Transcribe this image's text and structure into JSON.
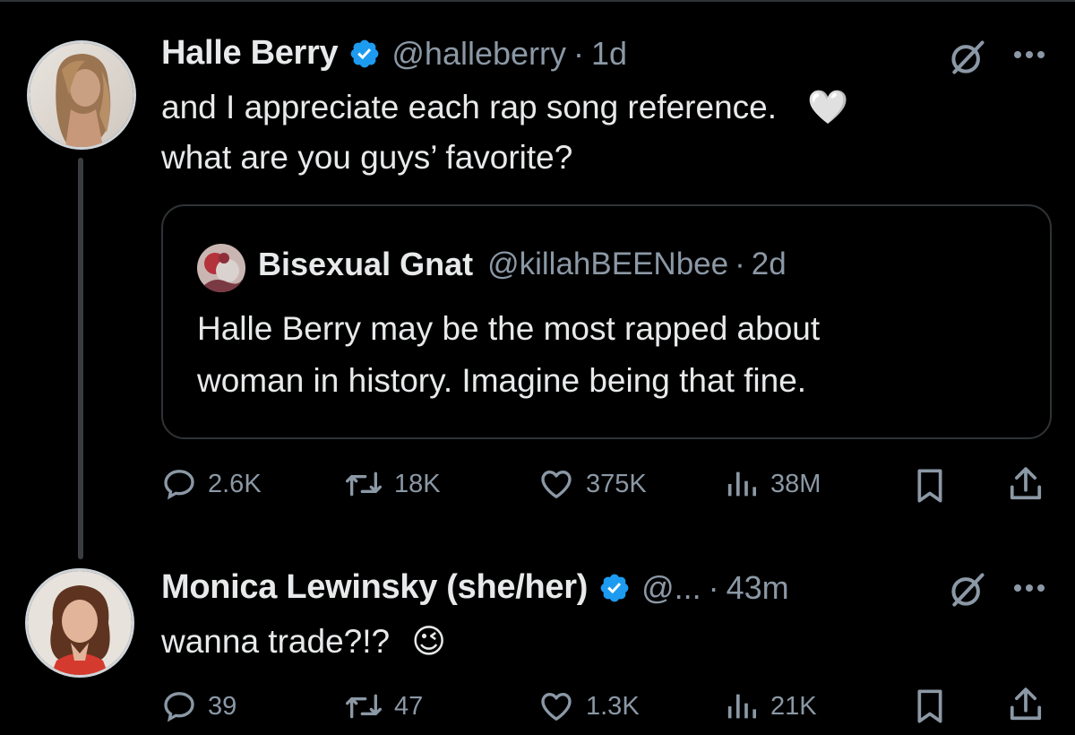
{
  "tweets": [
    {
      "display_name": "Halle Berry",
      "handle": "@halleberry",
      "time": "1d",
      "text_lines": [
        "and I appreciate each rap song reference.",
        "what are you guys’ favorite?"
      ],
      "emoji": "🤍",
      "avatar_icon": "portrait-avatar",
      "quote": {
        "display_name": "Bisexual Gnat",
        "handle": "@killahBEENbee",
        "time": "2d",
        "text_lines": [
          "Halle Berry may be the most rapped about",
          "woman in history. Imagine being that fine."
        ]
      },
      "actions": {
        "replies": "2.6K",
        "reposts": "18K",
        "likes": "375K",
        "views": "38M"
      }
    },
    {
      "display_name": "Monica Lewinsky (she/her)",
      "handle": "@...",
      "time": "43m",
      "text_lines": [
        "wanna trade?!?"
      ],
      "emoji": "😉",
      "avatar_icon": "portrait-avatar",
      "actions": {
        "replies": "39",
        "reposts": "47",
        "likes": "1.3K",
        "views": "21K"
      }
    }
  ],
  "separator": "·",
  "colors": {
    "background": "#000000",
    "text": "#e7e9ea",
    "muted": "#8b98a5",
    "verified": "#1d9bf0",
    "border": "#2f3336"
  }
}
